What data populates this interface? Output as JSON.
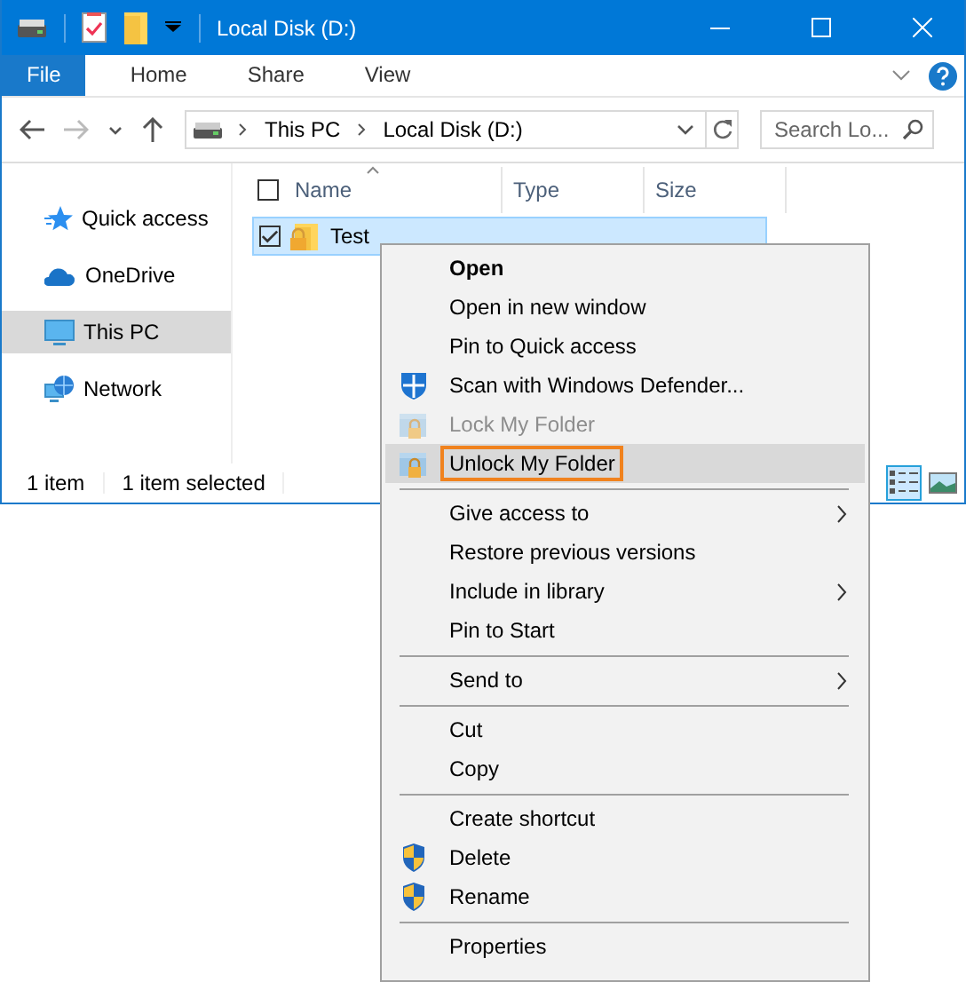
{
  "window": {
    "title": "Local Disk (D:)"
  },
  "ribbon_tabs": [
    {
      "label": "File",
      "selected": true
    },
    {
      "label": "Home",
      "selected": false
    },
    {
      "label": "Share",
      "selected": false
    },
    {
      "label": "View",
      "selected": false
    }
  ],
  "nav_buttons": [
    {
      "kind": "back",
      "disabled": false
    },
    {
      "kind": "forward",
      "disabled": true
    },
    {
      "kind": "recent",
      "disabled": false
    },
    {
      "kind": "up",
      "disabled": false
    }
  ],
  "address": {
    "path": [
      "This PC",
      "Local Disk (D:)"
    ]
  },
  "search": {
    "placeholder": "Search Lo..."
  },
  "sidebar": {
    "items": [
      {
        "label": "Quick access",
        "kind": "quick",
        "selected": false
      },
      {
        "label": "OneDrive",
        "kind": "cloud",
        "selected": false
      },
      {
        "label": "This PC",
        "kind": "computer",
        "selected": true
      },
      {
        "label": "Network",
        "kind": "network",
        "selected": false
      }
    ]
  },
  "header_checkbox": {
    "checked": false
  },
  "columns": [
    "Name",
    "Type",
    "Size"
  ],
  "rows": [
    {
      "name": "Test",
      "checked": true,
      "selected": true
    }
  ],
  "status_bar": {
    "count": "1 item",
    "selection": "1 item selected"
  },
  "views": [
    {
      "kind": "details",
      "selected": true
    },
    {
      "kind": "large-icons",
      "selected": false
    }
  ],
  "context_menu": {
    "items": [
      {
        "kind": "item",
        "label": "Open",
        "bold": true,
        "disabled": false,
        "selected": false,
        "submenu": false
      },
      {
        "kind": "item",
        "label": "Open in new window",
        "bold": false,
        "disabled": false,
        "selected": false,
        "submenu": false
      },
      {
        "kind": "item",
        "label": "Pin to Quick access",
        "bold": false,
        "disabled": false,
        "selected": false,
        "submenu": false
      },
      {
        "kind": "scan",
        "label": "Scan with Windows Defender...",
        "bold": false,
        "disabled": false,
        "selected": false,
        "submenu": false
      },
      {
        "kind": "lock",
        "label": "Lock My Folder",
        "bold": false,
        "disabled": true,
        "selected": false,
        "submenu": false
      },
      {
        "kind": "lock",
        "label": "Unlock My Folder",
        "bold": false,
        "disabled": false,
        "selected": true,
        "submenu": false
      },
      {
        "kind": "separator"
      },
      {
        "kind": "item",
        "label": "Give access to",
        "bold": false,
        "disabled": false,
        "selected": false,
        "submenu": true
      },
      {
        "kind": "item",
        "label": "Restore previous versions",
        "bold": false,
        "disabled": false,
        "selected": false,
        "submenu": false
      },
      {
        "kind": "item",
        "label": "Include in library",
        "bold": false,
        "disabled": false,
        "selected": false,
        "submenu": true
      },
      {
        "kind": "item",
        "label": "Pin to Start",
        "bold": false,
        "disabled": false,
        "selected": false,
        "submenu": false
      },
      {
        "kind": "separator"
      },
      {
        "kind": "item",
        "label": "Send to",
        "bold": false,
        "disabled": false,
        "selected": false,
        "submenu": true
      },
      {
        "kind": "separator"
      },
      {
        "kind": "item",
        "label": "Cut",
        "bold": false,
        "disabled": false,
        "selected": false,
        "submenu": false
      },
      {
        "kind": "item",
        "label": "Copy",
        "bold": false,
        "disabled": false,
        "selected": false,
        "submenu": false
      },
      {
        "kind": "separator"
      },
      {
        "kind": "item",
        "label": "Create shortcut",
        "bold": false,
        "disabled": false,
        "selected": false,
        "submenu": false
      },
      {
        "kind": "admin",
        "label": "Delete",
        "bold": false,
        "disabled": false,
        "selected": false,
        "submenu": false
      },
      {
        "kind": "admin",
        "label": "Rename",
        "bold": false,
        "disabled": false,
        "selected": false,
        "submenu": false
      },
      {
        "kind": "separator"
      },
      {
        "kind": "item",
        "label": "Properties",
        "bold": false,
        "disabled": false,
        "selected": false,
        "submenu": false
      }
    ]
  }
}
